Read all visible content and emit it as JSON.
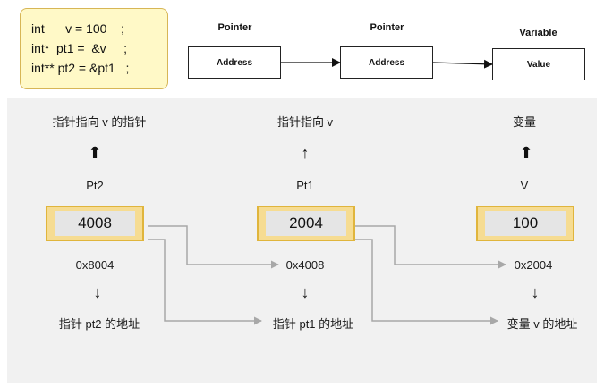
{
  "code": {
    "lines": [
      "int      v = 100    ;",
      "int*  pt1 =  &v     ;",
      "int** pt2 = &pt1   ;"
    ]
  },
  "top_row": {
    "headers": [
      "Pointer",
      "Pointer",
      "Variable"
    ],
    "boxes": [
      "Address",
      "Address",
      "Value"
    ]
  },
  "columns": [
    {
      "desc": "指针指向 v 的指针",
      "up_arrow": "⬆",
      "name": "Pt2",
      "value": "4008",
      "address": "0x8004",
      "down_arrow": "↓",
      "address_desc": "指针 pt2 的地址"
    },
    {
      "desc": "指针指向 v",
      "up_arrow": "↑",
      "name": "Pt1",
      "value": "2004",
      "address": "0x4008",
      "down_arrow": "↓",
      "address_desc": "指针 pt1 的地址"
    },
    {
      "desc": "变量",
      "up_arrow": "⬆",
      "name": "V",
      "value": "100",
      "address": "0x2004",
      "down_arrow": "↓",
      "address_desc": "变量 v 的地址"
    }
  ],
  "colors": {
    "panel_bg": "#f1f1f1",
    "code_bg": "#fff9c7",
    "var_fill": "#f6dc92",
    "var_border": "#e0b53c",
    "connector": "#a8a8a8"
  }
}
